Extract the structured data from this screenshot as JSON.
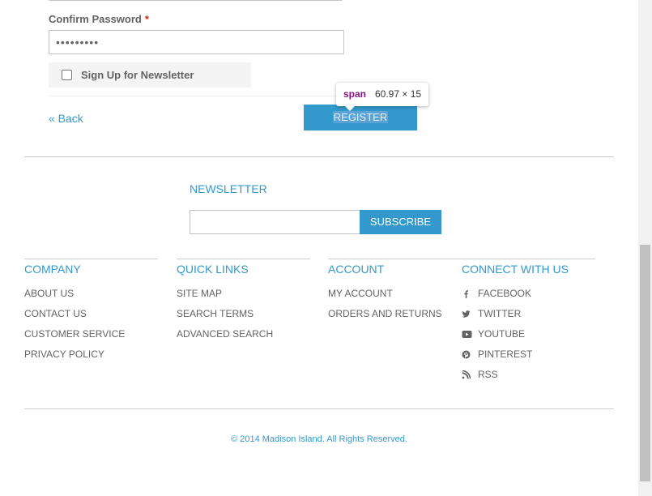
{
  "form": {
    "confirm_label": "Confirm Password",
    "required_mark": "*",
    "confirm_value": "•••••••••",
    "newsletter_label": "Sign Up for Newsletter",
    "back_link": "« Back",
    "register_label": "Register"
  },
  "devtools_tooltip": {
    "tag": "span",
    "dimensions": "60.97 × 15"
  },
  "newsletter": {
    "title": "Newsletter",
    "input_value": "",
    "subscribe_label": "Subscribe"
  },
  "footer": {
    "columns": [
      {
        "title": "Company",
        "links": [
          "About Us",
          "Contact Us",
          "Customer Service",
          "Privacy Policy"
        ]
      },
      {
        "title": "Quick Links",
        "links": [
          "Site Map",
          "Search Terms",
          "Advanced Search"
        ]
      },
      {
        "title": "Account",
        "links": [
          "My Account",
          "Orders and Returns"
        ]
      },
      {
        "title": "Connect With Us",
        "links": [
          {
            "label": "Facebook",
            "icon": "facebook-icon"
          },
          {
            "label": "Twitter",
            "icon": "twitter-icon"
          },
          {
            "label": "Youtube",
            "icon": "youtube-icon"
          },
          {
            "label": "Pinterest",
            "icon": "pinterest-icon"
          },
          {
            "label": "RSS",
            "icon": "rss-icon"
          }
        ]
      }
    ],
    "copyright": "© 2014 Madison Island. All Rights Reserved."
  },
  "colors": {
    "accent": "#3399cc",
    "text": "#636363",
    "required": "#df280a"
  }
}
